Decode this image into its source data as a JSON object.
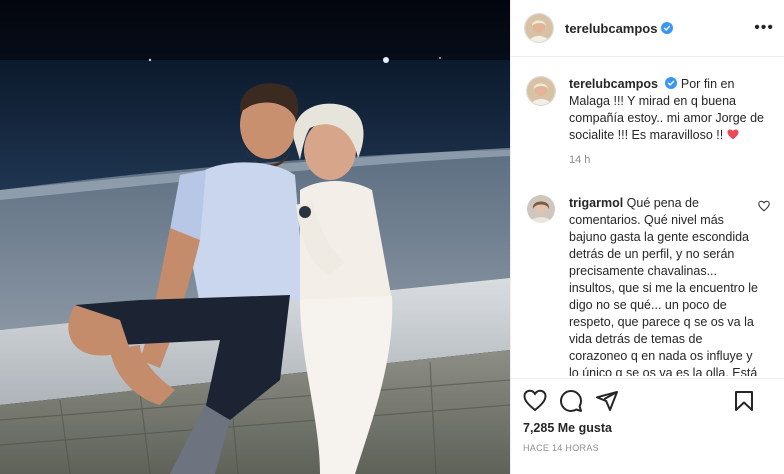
{
  "post": {
    "username": "terelubcampos",
    "more_label": "•••",
    "image_description_icon": "photo-couple-night-seaside"
  },
  "caption": {
    "username": "terelubcampos",
    "text": "Por fin en Malaga !!! Y mirad en q buena compañía estoy.. mi amor Jorge de socialite !!! Es maravilloso !!",
    "emoji": "heart-emoji",
    "time": "14 h"
  },
  "comments": [
    {
      "username": "trigarmol",
      "text": "Qué pena de comentarios. Qué nivel más bajuno gasta la gente escondida detrás de un perfil, y no serán precisamente chavalinas... insultos, que si me la encuentro le digo no se qué... un poco de respeto, que parece q se os va la vida detrás de temas de corazoneo q en nada os influye y lo único q se os va es la olla. Está en su ciudad e irá lo q le dé la gana. Un poco de respeto entre"
    }
  ],
  "stats": {
    "likes": "7,285 Me gusta",
    "posted": "HACE 14 HORAS"
  },
  "colors": {
    "verified": "#3897f0",
    "heart": "#ed4956",
    "text": "#262626",
    "muted": "#8e8e8e",
    "border": "#efefef"
  }
}
